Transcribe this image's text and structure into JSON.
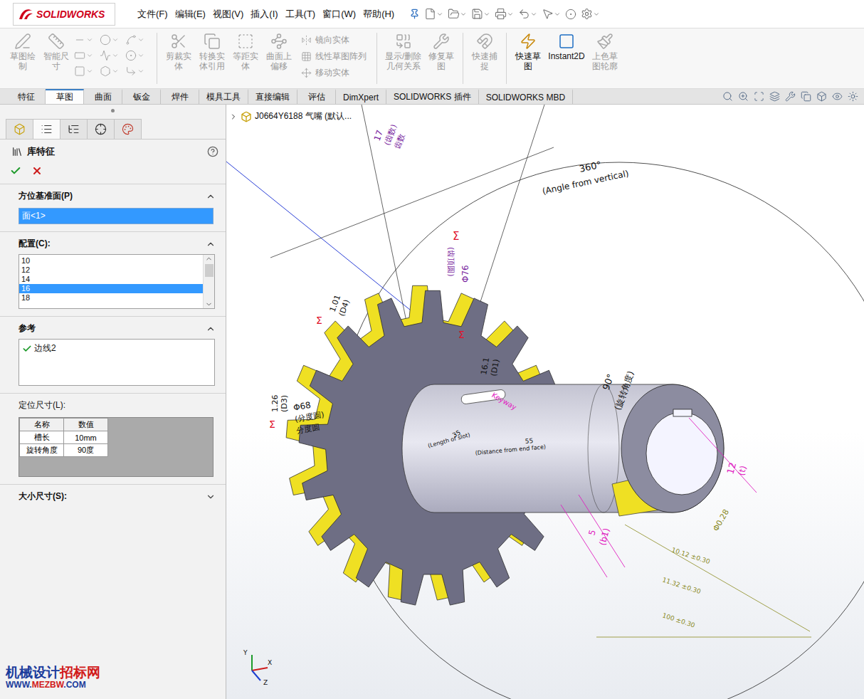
{
  "app": {
    "logo": "SOLIDWORKS"
  },
  "menu": [
    "文件(F)",
    "编辑(E)",
    "视图(V)",
    "插入(I)",
    "工具(T)",
    "窗口(W)",
    "帮助(H)"
  ],
  "ribbon": [
    {
      "kind": "large",
      "label": "草图绘\n制",
      "disabled": true
    },
    {
      "kind": "large",
      "label": "智能尺\n寸",
      "disabled": true
    },
    {
      "kind": "icon-grid",
      "disabled": true
    },
    {
      "kind": "separator"
    },
    {
      "kind": "large",
      "label": "剪裁实\n体",
      "disabled": true
    },
    {
      "kind": "large",
      "label": "转换实\n体引用",
      "disabled": true
    },
    {
      "kind": "large",
      "label": "等距实\n体",
      "disabled": true
    },
    {
      "kind": "large",
      "label": "曲面上\n偏移",
      "disabled": true
    },
    {
      "kind": "list",
      "items": [
        {
          "label": "镜向实体",
          "disabled": true
        },
        {
          "label": "线性草图阵列",
          "disabled": true
        },
        {
          "label": "移动实体",
          "disabled": true
        }
      ]
    },
    {
      "kind": "separator"
    },
    {
      "kind": "large",
      "label": "显示/删除\n几何关系",
      "disabled": true
    },
    {
      "kind": "large",
      "label": "修复草\n图",
      "disabled": true
    },
    {
      "kind": "separator"
    },
    {
      "kind": "large",
      "label": "快速捕\n捉",
      "disabled": true
    },
    {
      "kind": "separator"
    },
    {
      "kind": "large",
      "label": "快速草\n图",
      "disabled": false
    },
    {
      "kind": "large",
      "label": "Instant2D",
      "disabled": false
    },
    {
      "kind": "large",
      "label": "上色草\n图轮廓",
      "disabled": true
    }
  ],
  "tabs": [
    {
      "label": "特征",
      "selected": false
    },
    {
      "label": "草图",
      "selected": true
    },
    {
      "label": "曲面",
      "selected": false
    },
    {
      "label": "钣金",
      "selected": false
    },
    {
      "label": "焊件",
      "selected": false
    },
    {
      "label": "模具工具",
      "selected": false
    },
    {
      "label": "直接编辑",
      "selected": false
    },
    {
      "label": "评估",
      "selected": false
    },
    {
      "label": "DimXpert",
      "selected": false
    },
    {
      "label": "SOLIDWORKS 插件",
      "selected": false
    },
    {
      "label": "SOLIDWORKS MBD",
      "selected": false
    }
  ],
  "property_manager": {
    "title": "库特征",
    "sections": [
      {
        "kind": "field",
        "title": "方位基准面(P)",
        "expanded": true,
        "value": "面<1>",
        "selected": true
      },
      {
        "kind": "list",
        "title": "配置(C):",
        "expanded": true,
        "items": [
          {
            "label": "10",
            "selected": false
          },
          {
            "label": "12",
            "selected": false
          },
          {
            "label": "14",
            "selected": false
          },
          {
            "label": "16",
            "selected": true
          },
          {
            "label": "18",
            "selected": false
          }
        ]
      },
      {
        "kind": "refs",
        "title": "参考",
        "expanded": true,
        "items": [
          {
            "label": "边线2",
            "checked": true
          }
        ]
      },
      {
        "kind": "table",
        "title": "定位尺寸(L):",
        "columns": [
          "名称",
          "数值"
        ],
        "rows": [
          [
            "槽长",
            "10mm"
          ],
          [
            "旋转角度",
            "90度"
          ]
        ]
      },
      {
        "kind": "collapsed",
        "title": "大小尺寸(S):",
        "expanded": false
      }
    ]
  },
  "graphics": {
    "tree_root": "J0664Y6188 气嘴 (默认...",
    "annotations": [
      {
        "text": "17",
        "color": "#7a1fa0"
      },
      {
        "text": "(齿数)",
        "color": "#7a1fa0"
      },
      {
        "text": "齿数",
        "color": "#7a1fa0"
      },
      {
        "text": "360°",
        "color": "#111111"
      },
      {
        "text": "(Angle from vertical)",
        "color": "#111111"
      },
      {
        "text": "Σ",
        "color": "#e0102a"
      },
      {
        "text": "(齿顶圆)",
        "color": "#7a1fa0"
      },
      {
        "text": "Φ76",
        "color": "#7a1fa0"
      },
      {
        "text": "1.01",
        "color": "#111111"
      },
      {
        "text": "(D4)",
        "color": "#111111"
      },
      {
        "text": "Σ",
        "color": "#e0102a"
      },
      {
        "text": "1.26",
        "color": "#111111"
      },
      {
        "text": "(D3)",
        "color": "#111111"
      },
      {
        "text": "Σ",
        "color": "#e0102a"
      },
      {
        "text": "Φ68",
        "color": "#111111"
      },
      {
        "text": "(分度圆)",
        "color": "#111111"
      },
      {
        "text": "分度圆",
        "color": "#111111"
      },
      {
        "text": "16.1",
        "color": "#111111"
      },
      {
        "text": "(D1)",
        "color": "#111111"
      },
      {
        "text": "Σ",
        "color": "#e0102a"
      },
      {
        "text": "90°",
        "color": "#111111"
      },
      {
        "text": "(旋转角度)",
        "color": "#111111"
      },
      {
        "text": "Keyway",
        "color": "#e020c0"
      },
      {
        "text": "35",
        "color": "#111111"
      },
      {
        "text": "(Length of slot)",
        "color": "#111111"
      },
      {
        "text": "55",
        "color": "#111111"
      },
      {
        "text": "(Distance from end face)",
        "color": "#111111"
      },
      {
        "text": "12",
        "color": "#e020c0"
      },
      {
        "text": "(t)",
        "color": "#e020c0"
      },
      {
        "text": "5",
        "color": "#e020c0"
      },
      {
        "text": "(b1)",
        "color": "#e020c0"
      },
      {
        "text": "Φ0.28",
        "color": "#8a8a1e"
      },
      {
        "text": "10.12 ±0.30",
        "color": "#8a8a1e"
      },
      {
        "text": "11.32 ±0.30",
        "color": "#8a8a1e"
      },
      {
        "text": "100 ±0.30",
        "color": "#8a8a1e"
      }
    ],
    "triad": [
      "Y",
      "X",
      "Z"
    ]
  },
  "watermark": {
    "line1": [
      {
        "text": "机械设计",
        "color": "#1a3c9c"
      },
      {
        "text": "招标网",
        "color": "#d11a1a"
      }
    ],
    "line2": [
      {
        "text": "WWW.",
        "color": "#1a3c9c"
      },
      {
        "text": "MEZBW",
        "color": "#d11a1a"
      },
      {
        "text": ".COM",
        "color": "#1a3c9c"
      }
    ]
  }
}
